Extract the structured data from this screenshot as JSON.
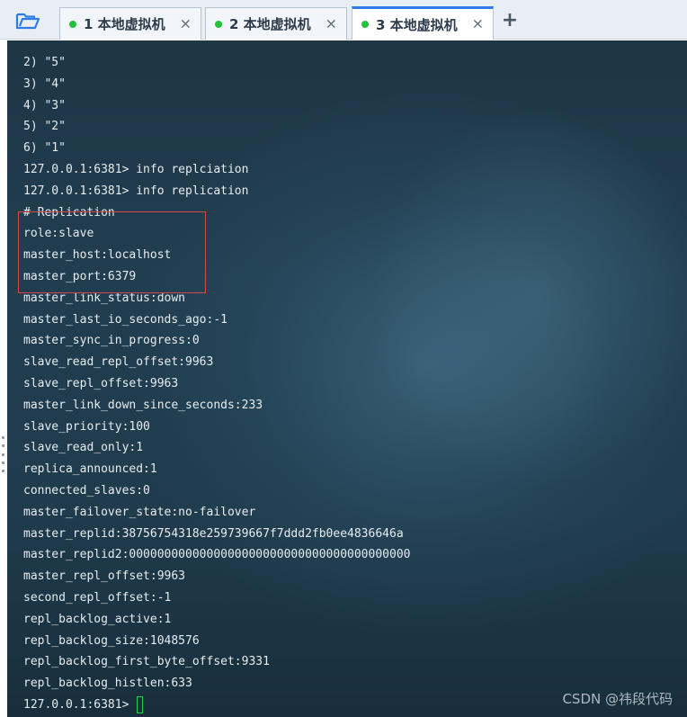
{
  "tabs": [
    {
      "number": "1",
      "title": "本地虚拟机",
      "close": "×",
      "active": false
    },
    {
      "number": "2",
      "title": "本地虚拟机",
      "close": "×",
      "active": false
    },
    {
      "number": "3",
      "title": "本地虚拟机",
      "close": "×",
      "active": true
    }
  ],
  "toolbar": {
    "new_tab_label": "+",
    "folder_icon": "folder-open-icon"
  },
  "terminal": {
    "lines": [
      "2) \"5\"",
      "3) \"4\"",
      "4) \"3\"",
      "5) \"2\"",
      "6) \"1\"",
      "127.0.0.1:6381> info replciation",
      "127.0.0.1:6381> info replication",
      "# Replication",
      "role:slave",
      "master_host:localhost",
      "master_port:6379",
      "master_link_status:down",
      "master_last_io_seconds_ago:-1",
      "master_sync_in_progress:0",
      "slave_read_repl_offset:9963",
      "slave_repl_offset:9963",
      "master_link_down_since_seconds:233",
      "slave_priority:100",
      "slave_read_only:1",
      "replica_announced:1",
      "connected_slaves:0",
      "master_failover_state:no-failover",
      "master_replid:38756754318e259739667f7ddd2fb0ee4836646a",
      "master_replid2:0000000000000000000000000000000000000000",
      "master_repl_offset:9963",
      "second_repl_offset:-1",
      "repl_backlog_active:1",
      "repl_backlog_size:1048576",
      "repl_backlog_first_byte_offset:9331",
      "repl_backlog_histlen:633"
    ],
    "prompt": "127.0.0.1:6381> "
  },
  "watermark": "CSDN @祎段代码",
  "colors": {
    "status_dot": "#22c33b",
    "active_tab_accent": "#2f7be8",
    "highlight_box": "#d9474d",
    "cursor": "#22d14a"
  }
}
